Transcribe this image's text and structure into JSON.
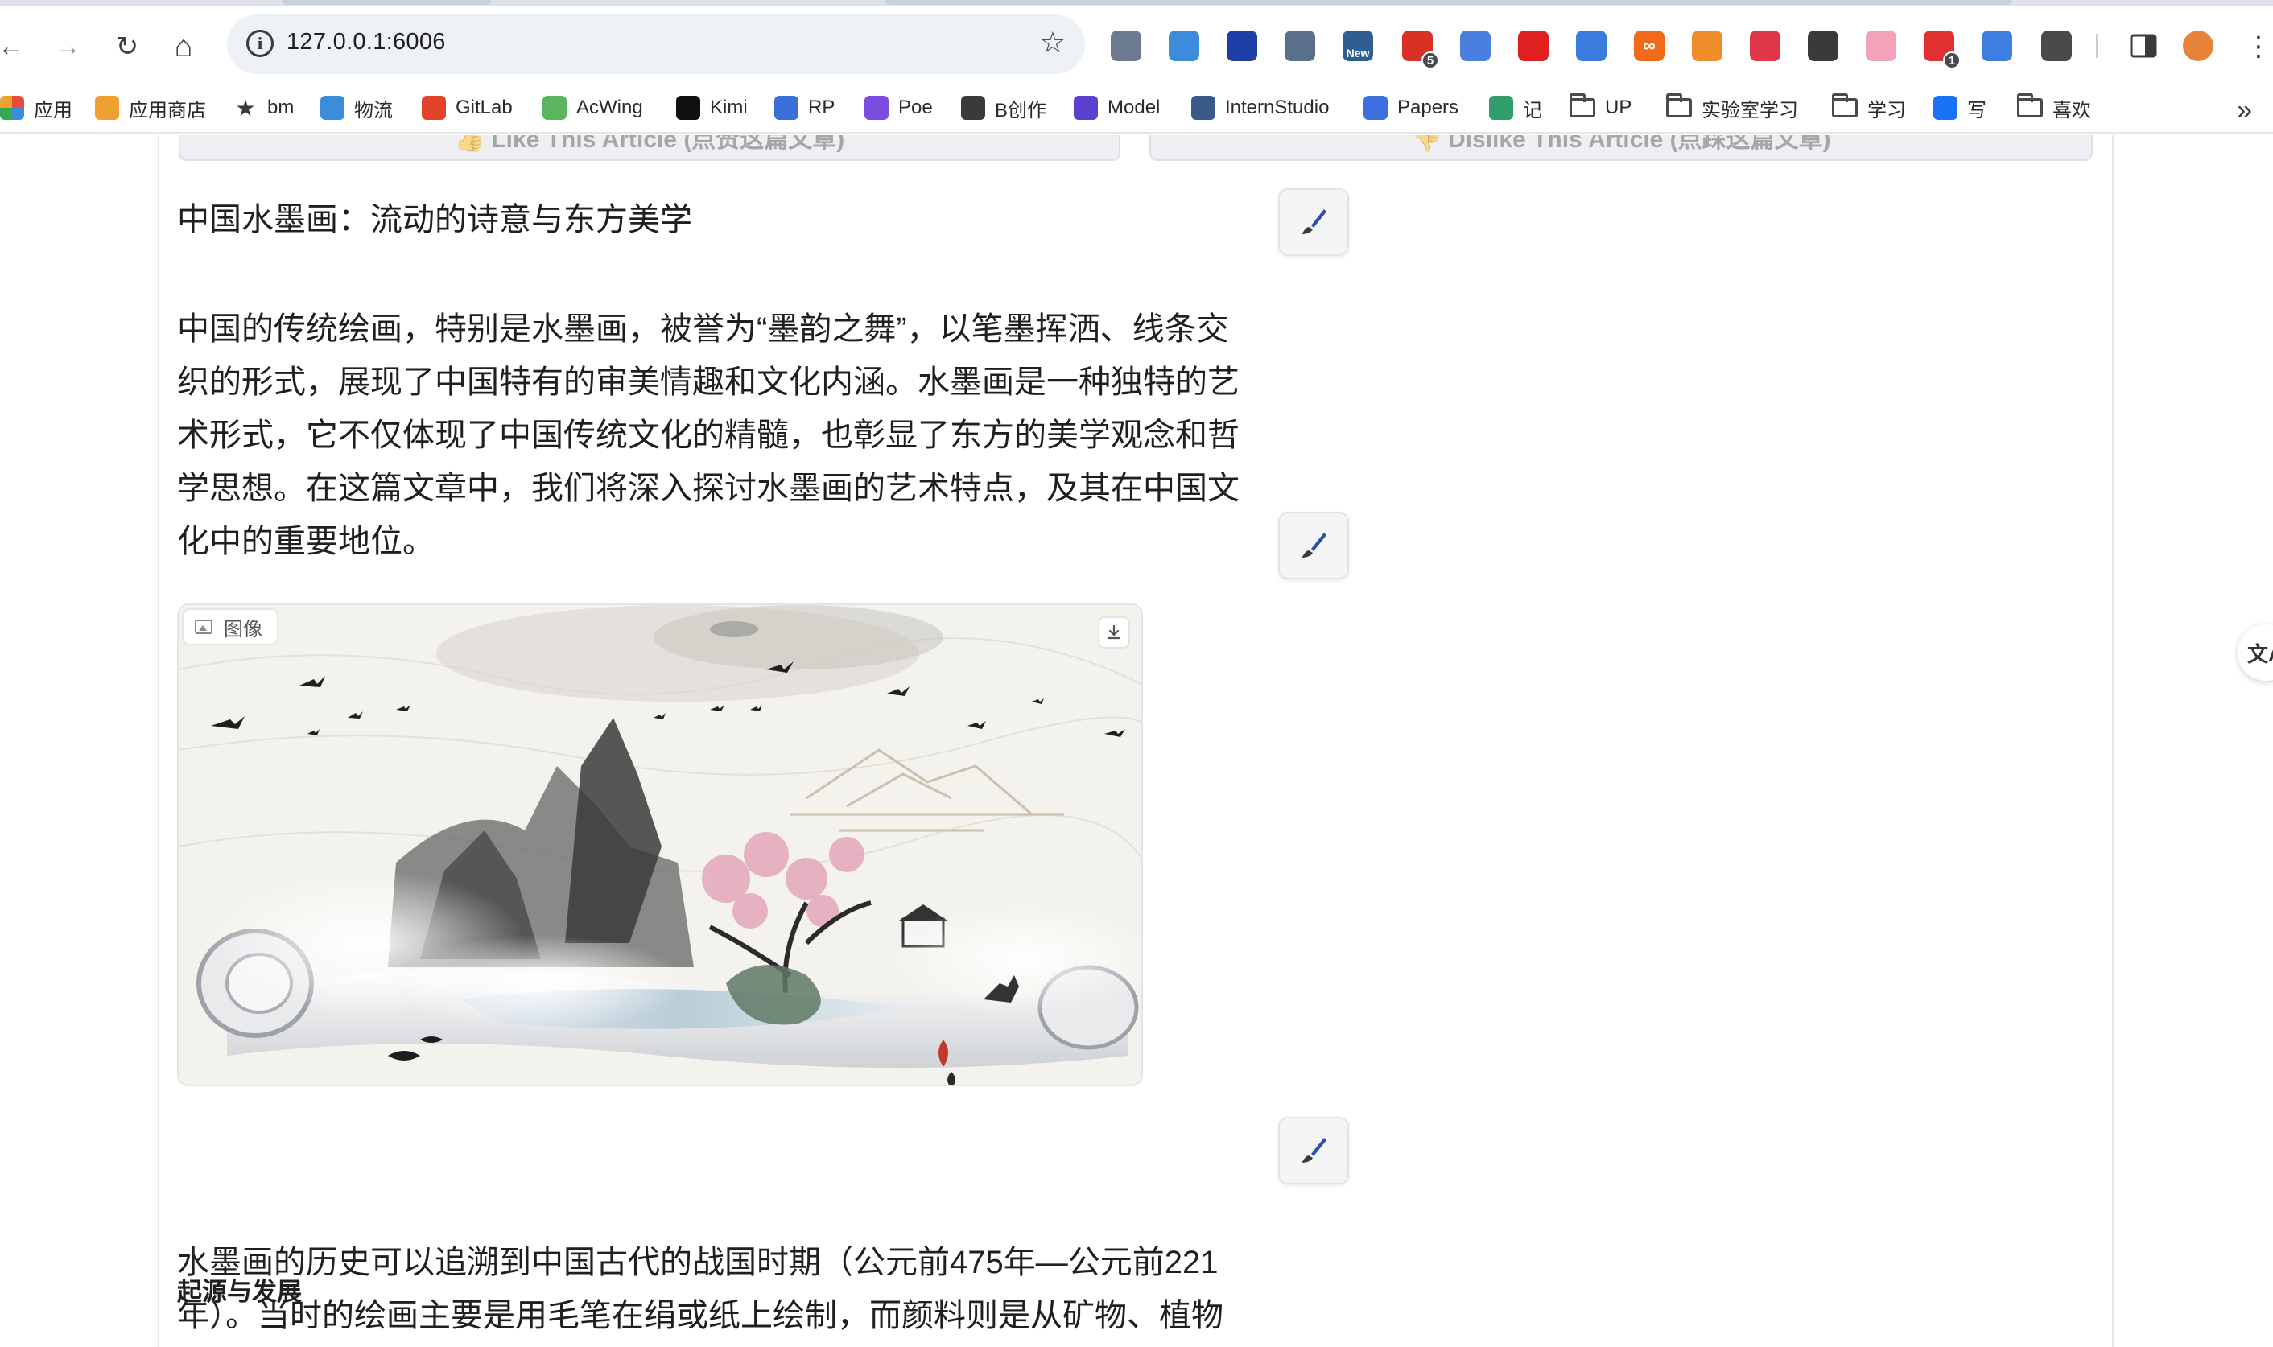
{
  "browser": {
    "url": "127.0.0.1:6006",
    "nav": {
      "back": "←",
      "forward": "→",
      "reload": "↻",
      "home": "⌂"
    },
    "extensions": [
      {
        "name": "extension-1-icon",
        "text": "",
        "color": "#6b7a8f"
      },
      {
        "name": "extension-2-icon",
        "text": "",
        "color": "#3d8bdb"
      },
      {
        "name": "extension-3-icon",
        "text": "",
        "color": "#1d3fa6"
      },
      {
        "name": "extension-4-icon",
        "text": "",
        "color": "#5a6f8a"
      },
      {
        "name": "extension-new-icon",
        "text": "New",
        "color": "#2e5f8f"
      },
      {
        "name": "extension-5-icon",
        "text": "",
        "color": "#d93025",
        "badge": "5"
      },
      {
        "name": "translate-extension-icon",
        "text": "",
        "color": "#4a7fe0"
      },
      {
        "name": "youtube-extension-icon",
        "text": "",
        "color": "#e02020"
      },
      {
        "name": "wave-extension-icon",
        "text": "",
        "color": "#3a7be0"
      },
      {
        "name": "infinity-extension-icon",
        "text": "∞",
        "color": "#f06a1a"
      },
      {
        "name": "orange-extension-icon",
        "text": "",
        "color": "#f08c2a"
      },
      {
        "name": "pocket-extension-icon",
        "text": "",
        "color": "#e0364a"
      },
      {
        "name": "image-extension-icon",
        "text": "",
        "color": "#3a3a3a"
      },
      {
        "name": "pink-extension-icon",
        "text": "",
        "color": "#f2a3b8"
      },
      {
        "name": "red-extension-icon",
        "text": "",
        "color": "#e03030",
        "badge": "1"
      },
      {
        "name": "blue-circle-extension-icon",
        "text": "",
        "color": "#3d7fe0"
      },
      {
        "name": "puzzle-extension-icon",
        "text": "",
        "color": "#4a4a4a"
      }
    ],
    "bookmarks": [
      {
        "label": "应用",
        "icon": "apps-grid-icon",
        "color": "#e84b3c"
      },
      {
        "label": "应用商店",
        "icon": "store-icon",
        "color": "#f0a030"
      },
      {
        "label": "bm",
        "icon": "star-icon",
        "color": "#3a3a3a"
      },
      {
        "label": "物流",
        "icon": "cloud-icon",
        "color": "#3d8bdb"
      },
      {
        "label": "GitLab",
        "icon": "gitlab-icon",
        "color": "#e24329"
      },
      {
        "label": "AcWing",
        "icon": "acwing-icon",
        "color": "#5bb55f"
      },
      {
        "label": "Kimi",
        "icon": "kimi-icon",
        "color": "#111111"
      },
      {
        "label": "RP",
        "icon": "rp-icon",
        "color": "#3a6fd8"
      },
      {
        "label": "Poe",
        "icon": "poe-icon",
        "color": "#7b4ce0"
      },
      {
        "label": "B创作",
        "icon": "bilibili-icon",
        "color": "#3a3a3a"
      },
      {
        "label": "Model",
        "icon": "model-icon",
        "color": "#5b3fd0"
      },
      {
        "label": "InternStudio",
        "icon": "internstudio-icon",
        "color": "#3a5a8a"
      },
      {
        "label": "Papers",
        "icon": "papers-icon",
        "color": "#3d6fe0"
      },
      {
        "label": "记",
        "icon": "sf-icon",
        "color": "#2f9e6b"
      },
      {
        "label": "UP",
        "icon": "folder-icon",
        "color": "#4a4a4a"
      },
      {
        "label": "实验室学习",
        "icon": "folder-icon",
        "color": "#4a4a4a"
      },
      {
        "label": "学习",
        "icon": "folder-icon",
        "color": "#4a4a4a"
      },
      {
        "label": "写",
        "icon": "zhihu-icon",
        "color": "#1772f6"
      },
      {
        "label": "喜欢",
        "icon": "folder-icon",
        "color": "#4a4a4a"
      }
    ]
  },
  "article": {
    "vote_like": "👍 Like This Article (点赞这篇文章)",
    "vote_dislike": "👎 Dislike This Article (点踩这篇文章)",
    "title": "中国水墨画：流动的诗意与东方美学",
    "intro": "中国的传统绘画，特别是水墨画，被誉为“墨韵之舞”，以笔墨挥洒、线条交织的形式，展现了中国特有的审美情趣和文化内涵。水墨画是一种独特的艺术形式，它不仅体现了中国传统文化的精髓，也彰显了东方的美学观念和哲学思想。在这篇文章中，我们将深入探讨水墨画的艺术特点，及其在中国文化中的重要地位。",
    "image_label": "图像",
    "section_heading": "起源与发展",
    "section_body": "水墨画的历史可以追溯到中国古代的战国时期（公元前475年—公元前221年）。当时的绘画主要是用毛笔在绢或纸上绘制，而颜料则是从矿物、植物"
  },
  "translate_tab": "文A"
}
